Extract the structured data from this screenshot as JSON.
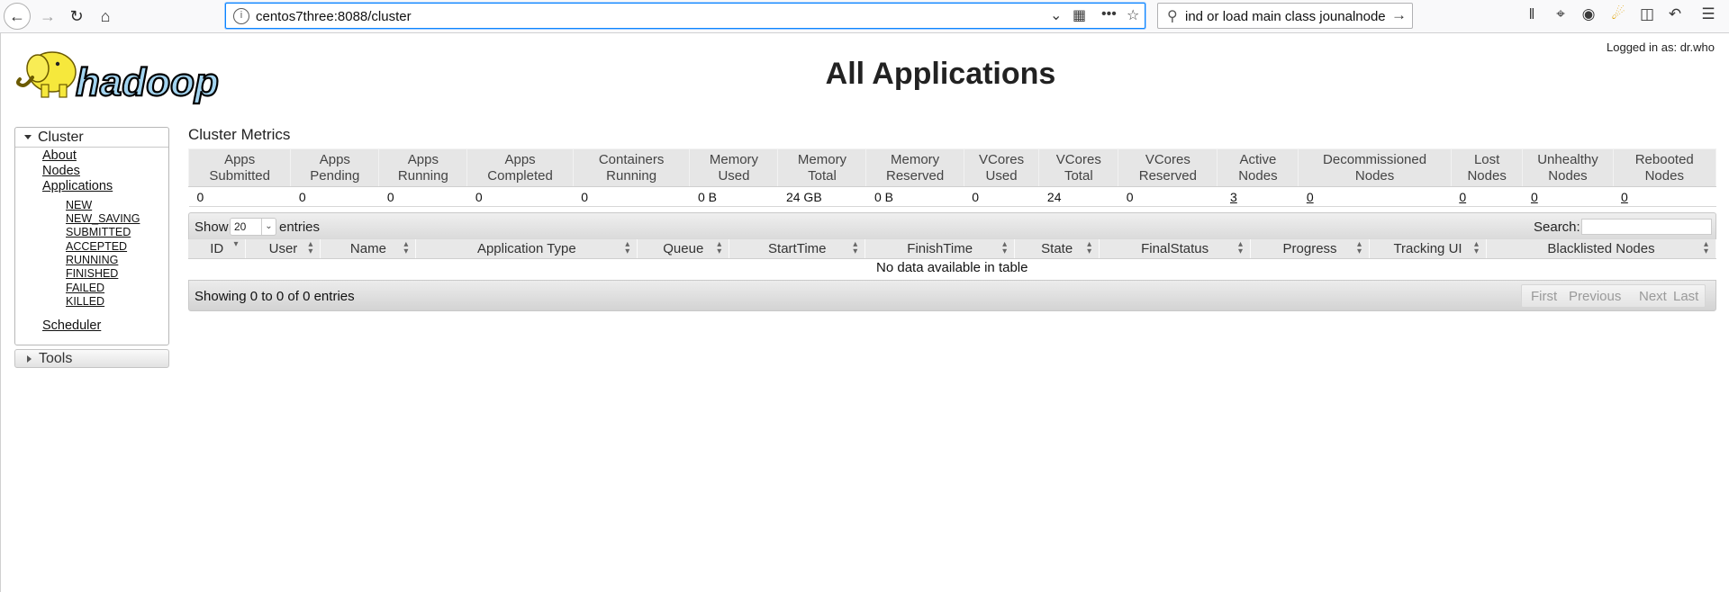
{
  "browser": {
    "url": "centos7three:8088/cluster",
    "search_text": "ind or load main class jounalnode"
  },
  "header": {
    "logged_in": "Logged in as: dr.who",
    "title": "All Applications",
    "logo_text": "hadoop"
  },
  "sidebar": {
    "cluster_label": "Cluster",
    "links": [
      "About",
      "Nodes",
      "Applications"
    ],
    "app_states": [
      "NEW",
      "NEW_SAVING",
      "SUBMITTED",
      "ACCEPTED",
      "RUNNING",
      "FINISHED",
      "FAILED",
      "KILLED"
    ],
    "scheduler_label": "Scheduler",
    "tools_label": "Tools"
  },
  "metrics": {
    "title": "Cluster Metrics",
    "headers": [
      [
        "Apps",
        "Submitted"
      ],
      [
        "Apps",
        "Pending"
      ],
      [
        "Apps",
        "Running"
      ],
      [
        "Apps",
        "Completed"
      ],
      [
        "Containers",
        "Running"
      ],
      [
        "Memory",
        "Used"
      ],
      [
        "Memory",
        "Total"
      ],
      [
        "Memory",
        "Reserved"
      ],
      [
        "VCores",
        "Used"
      ],
      [
        "VCores",
        "Total"
      ],
      [
        "VCores",
        "Reserved"
      ],
      [
        "Active",
        "Nodes"
      ],
      [
        "Decommissioned",
        "Nodes"
      ],
      [
        "Lost",
        "Nodes"
      ],
      [
        "Unhealthy",
        "Nodes"
      ],
      [
        "Rebooted",
        "Nodes"
      ]
    ],
    "values": [
      "0",
      "0",
      "0",
      "0",
      "0",
      "0 B",
      "24 GB",
      "0 B",
      "0",
      "24",
      "0",
      "3",
      "0",
      "0",
      "0",
      "0"
    ]
  },
  "apps_table": {
    "show_label": "Show",
    "entries_value": "20",
    "entries_label": "entries",
    "search_label": "Search:",
    "columns": [
      "ID",
      "User",
      "Name",
      "Application Type",
      "Queue",
      "StartTime",
      "FinishTime",
      "State",
      "FinalStatus",
      "Progress",
      "Tracking UI",
      "Blacklisted Nodes"
    ],
    "empty_message": "No data available in table",
    "info": "Showing 0 to 0 of 0 entries",
    "pager": [
      "First",
      "Previous",
      "Next",
      "Last"
    ]
  }
}
